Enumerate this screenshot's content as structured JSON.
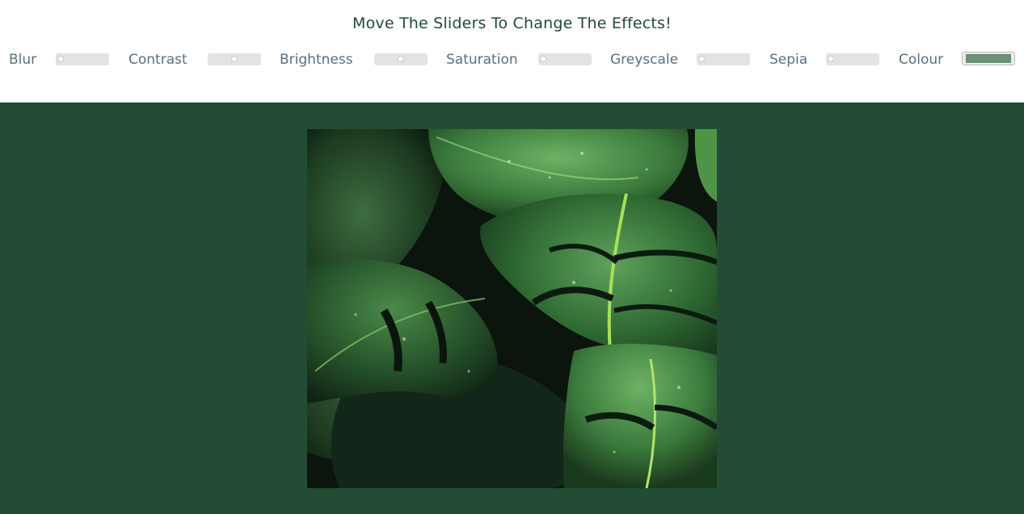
{
  "header": {
    "title": "Move The Sliders To Change The Effects!"
  },
  "controls": [
    {
      "label": "Blur",
      "value": 0
    },
    {
      "label": "Contrast",
      "value": 0.5
    },
    {
      "label": "Brightness",
      "value": 0.5
    },
    {
      "label": "Saturation",
      "value": 0
    },
    {
      "label": "Greyscale",
      "value": 0
    },
    {
      "label": "Sepia",
      "value": 0
    },
    {
      "label": "Colour",
      "color": "#6a8f74"
    }
  ],
  "colors": {
    "stage_background": "#234c35",
    "title": "#224a33",
    "label": "#5a6f7d"
  },
  "image": {
    "subject": "monstera leaves with water droplets"
  }
}
